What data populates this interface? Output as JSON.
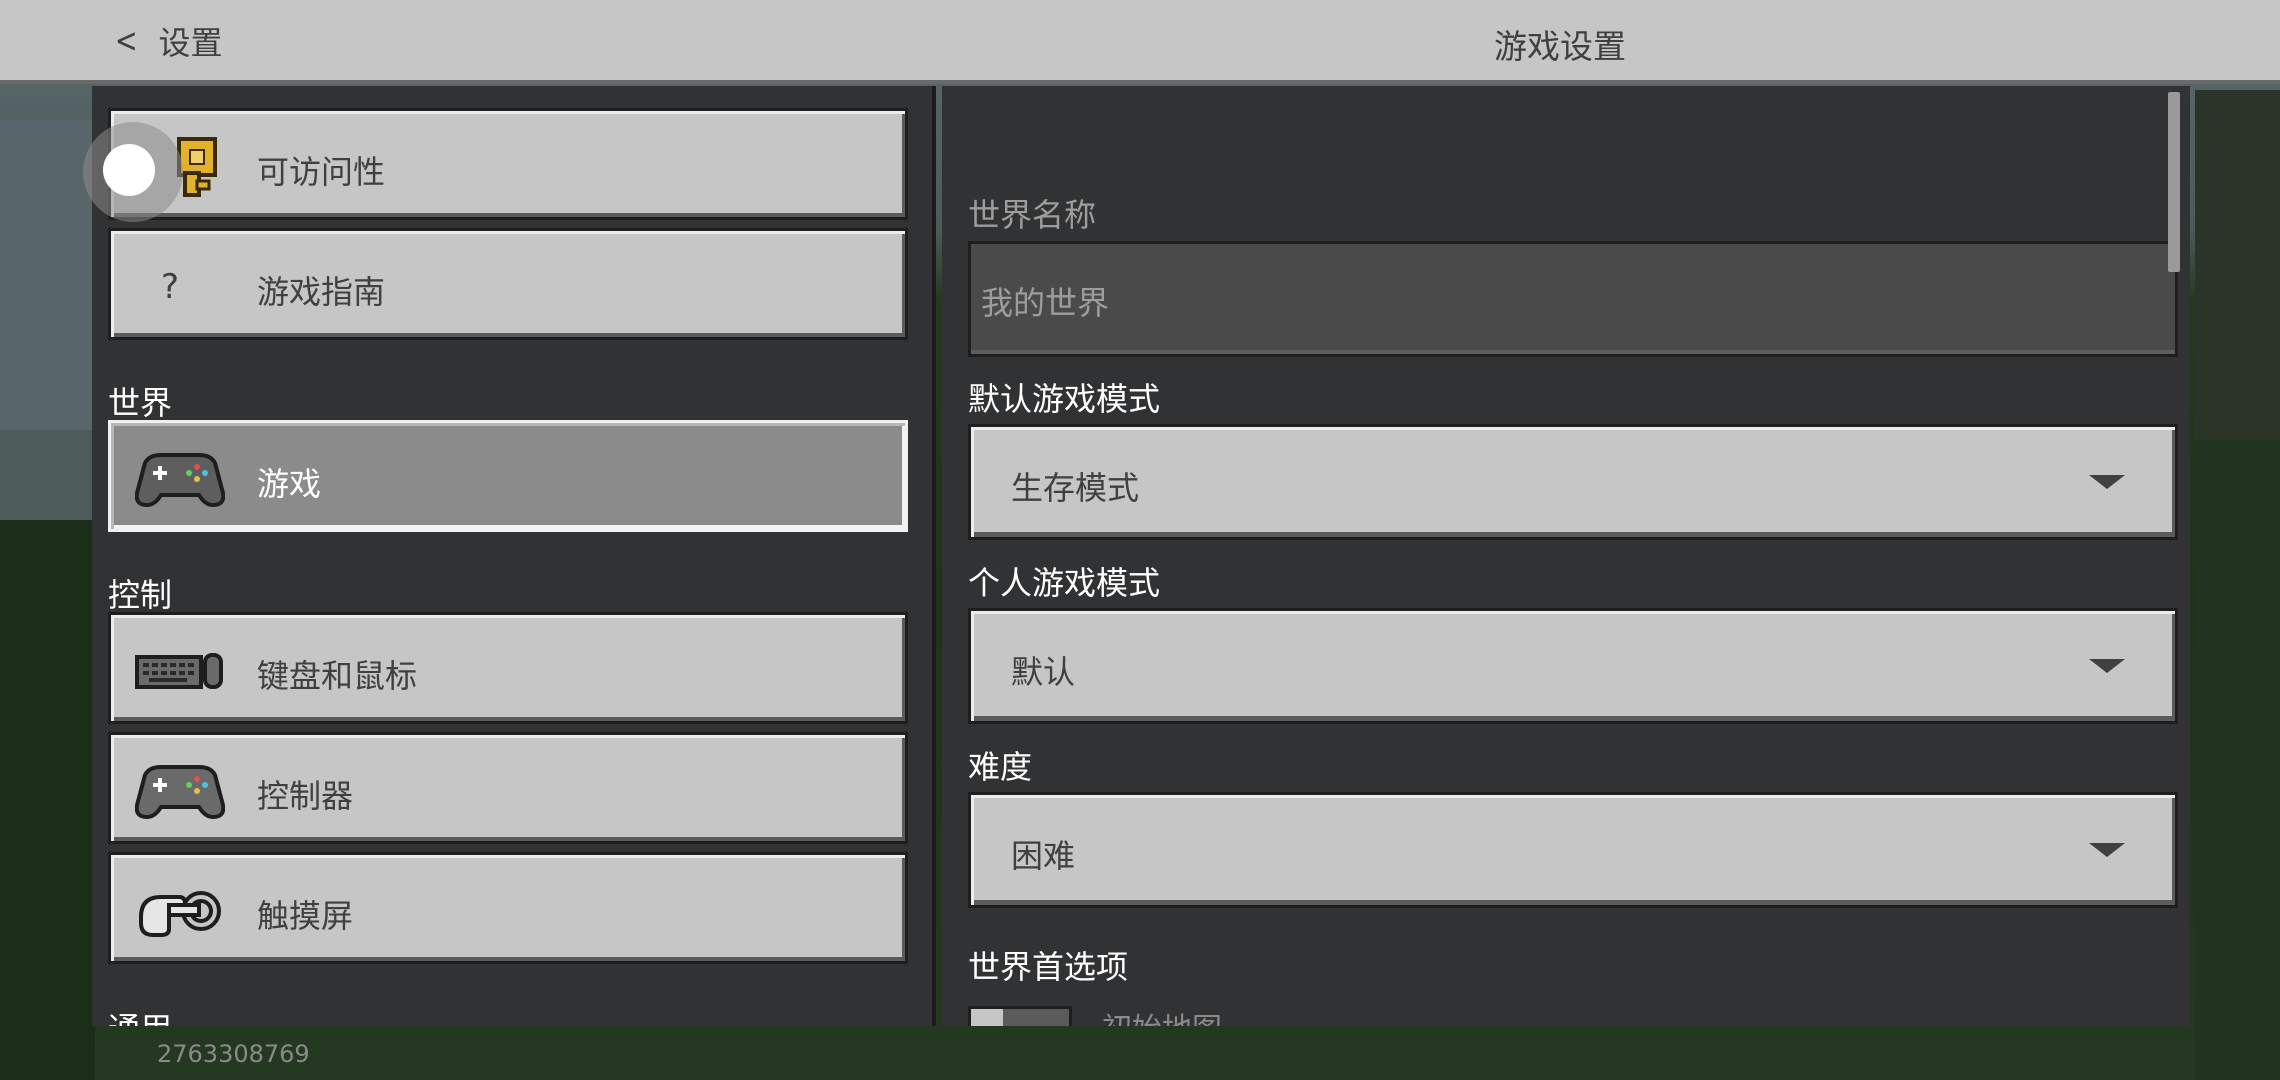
{
  "header": {
    "back_label": "设置",
    "title": "游戏设置"
  },
  "sidebar": {
    "items_top": [
      {
        "label": "可访问性",
        "icon": "key-icon"
      },
      {
        "label": "游戏指南",
        "icon": "question-icon",
        "icon_glyph": "?"
      }
    ],
    "section_world": "世界",
    "world_items": [
      {
        "label": "游戏",
        "icon": "gamepad-icon",
        "active": true
      }
    ],
    "section_controls": "控制",
    "control_items": [
      {
        "label": "键盘和鼠标",
        "icon": "keyboard-mouse-icon"
      },
      {
        "label": "控制器",
        "icon": "gamepad-icon"
      },
      {
        "label": "触摸屏",
        "icon": "touch-hand-icon"
      }
    ],
    "section_general": "通用"
  },
  "main": {
    "world_name_label": "世界名称",
    "world_name_value": "我的世界",
    "default_mode_label": "默认游戏模式",
    "default_mode_value": "生存模式",
    "personal_mode_label": "个人游戏模式",
    "personal_mode_value": "默认",
    "difficulty_label": "难度",
    "difficulty_value": "困难",
    "world_prefs_label": "世界首选项",
    "starting_map_label": "初始地图"
  },
  "footer": {
    "uid": "2763308769"
  },
  "colors": {
    "button_face": "#c6c6c6",
    "active_button": "#8c8b8c",
    "panel": "#313233",
    "header": "#c6c6c6"
  }
}
